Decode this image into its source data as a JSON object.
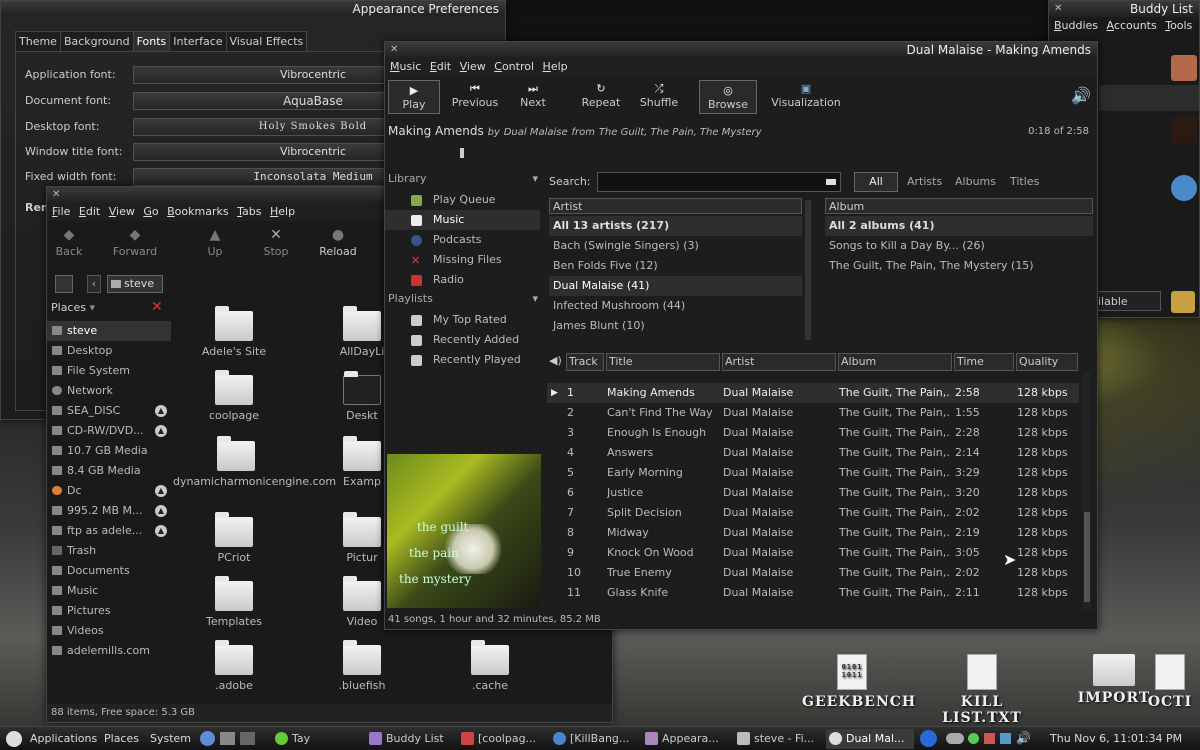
{
  "appearance": {
    "title": "Appearance Preferences",
    "tabs": [
      "Theme",
      "Background",
      "Fonts",
      "Interface",
      "Visual Effects"
    ],
    "rows": [
      {
        "label": "Application font:",
        "value": "Vibrocentric"
      },
      {
        "label": "Document font:",
        "value": "AquaBase"
      },
      {
        "label": "Desktop font:",
        "value": "Holy Smokes Bold"
      },
      {
        "label": "Window title font:",
        "value": "Vibrocentric"
      },
      {
        "label": "Fixed width font:",
        "value": "Inconsolata Medium"
      }
    ],
    "partial_label": "Ren"
  },
  "files": {
    "menu": [
      "File",
      "Edit",
      "View",
      "Go",
      "Bookmarks",
      "Tabs",
      "Help"
    ],
    "toolbar": [
      "Back",
      "Forward",
      "Up",
      "Stop",
      "Reload"
    ],
    "location": "steve",
    "places_label": "Places",
    "places": [
      "steve",
      "Desktop",
      "File System",
      "Network",
      "SEA_DISC",
      "CD-RW/DVD...",
      "10.7 GB Media",
      "8.4 GB Media",
      "Dc",
      "995.2 MB M...",
      "ftp as adele...",
      "Trash",
      "Documents",
      "Music",
      "Pictures",
      "Videos",
      "adelemills.com"
    ],
    "items": [
      "Adele's Site",
      "AllDayLi",
      "coolpage",
      "Deskt",
      "dynamicharmonicengine.com",
      "Examp",
      "PCriot",
      "Pictur",
      "Templates",
      "Video",
      ".adobe",
      ".bluefish",
      ".cache"
    ],
    "status": "88 items, Free space: 5.3 GB"
  },
  "music": {
    "title": "Dual Malaise - Making Amends",
    "menu": [
      "Music",
      "Edit",
      "View",
      "Control",
      "Help"
    ],
    "toolbar": [
      "Play",
      "Previous",
      "Next",
      "Repeat",
      "Shuffle",
      "Browse",
      "Visualization"
    ],
    "song": "Making Amends",
    "by": "by",
    "artist": "Dual Malaise",
    "from": "from",
    "album": "The Guilt, The Pain, The Mystery",
    "time": "0:18 of 2:58",
    "library_label": "Library",
    "library": [
      "Play Queue",
      "Music",
      "Podcasts",
      "Missing Files",
      "Radio"
    ],
    "playlists_label": "Playlists",
    "playlists": [
      "My Top Rated",
      "Recently Added",
      "Recently Played"
    ],
    "search_label": "Search:",
    "filters": [
      "All",
      "Artists",
      "Albums",
      "Titles"
    ],
    "artist_header": "Artist",
    "artists": [
      "All 13 artists (217)",
      "Bach (Swingle Singers) (3)",
      "Ben Folds Five (12)",
      "Dual Malaise (41)",
      "Infected Mushroom (44)",
      "James Blunt (10)"
    ],
    "album_header": "Album",
    "albums": [
      "All 2 albums (41)",
      "Songs to Kill a Day By... (26)",
      "The Guilt, The Pain, The Mystery (15)"
    ],
    "columns": [
      "Track",
      "Title",
      "Artist",
      "Album",
      "Time",
      "Quality"
    ],
    "tracks": [
      {
        "n": "1",
        "title": "Making Amends",
        "artist": "Dual Malaise",
        "album": "The Guilt, The Pain,...",
        "time": "2:58",
        "q": "128 kbps"
      },
      {
        "n": "2",
        "title": "Can't Find The Way",
        "artist": "Dual Malaise",
        "album": "The Guilt, The Pain,...",
        "time": "1:55",
        "q": "128 kbps"
      },
      {
        "n": "3",
        "title": "Enough Is Enough",
        "artist": "Dual Malaise",
        "album": "The Guilt, The Pain,...",
        "time": "2:28",
        "q": "128 kbps"
      },
      {
        "n": "4",
        "title": "Answers",
        "artist": "Dual Malaise",
        "album": "The Guilt, The Pain,...",
        "time": "2:14",
        "q": "128 kbps"
      },
      {
        "n": "5",
        "title": "Early Morning",
        "artist": "Dual Malaise",
        "album": "The Guilt, The Pain,...",
        "time": "3:29",
        "q": "128 kbps"
      },
      {
        "n": "6",
        "title": "Justice",
        "artist": "Dual Malaise",
        "album": "The Guilt, The Pain,...",
        "time": "3:20",
        "q": "128 kbps"
      },
      {
        "n": "7",
        "title": "Split Decision",
        "artist": "Dual Malaise",
        "album": "The Guilt, The Pain,...",
        "time": "2:02",
        "q": "128 kbps"
      },
      {
        "n": "8",
        "title": "Midway",
        "artist": "Dual Malaise",
        "album": "The Guilt, The Pain,...",
        "time": "2:19",
        "q": "128 kbps"
      },
      {
        "n": "9",
        "title": "Knock On Wood",
        "artist": "Dual Malaise",
        "album": "The Guilt, The Pain,...",
        "time": "3:05",
        "q": "128 kbps"
      },
      {
        "n": "10",
        "title": "True Enemy",
        "artist": "Dual Malaise",
        "album": "The Guilt, The Pain,...",
        "time": "2:02",
        "q": "128 kbps"
      },
      {
        "n": "11",
        "title": "Glass Knife",
        "artist": "Dual Malaise",
        "album": "The Guilt, The Pain,...",
        "time": "2:11",
        "q": "128 kbps"
      }
    ],
    "art_lines": [
      "the guilt",
      "the pain",
      "the mystery"
    ],
    "status": "41 songs, 1 hour and 32 minutes, 85.2 MB"
  },
  "buddy": {
    "title": "Buddy List",
    "menu": [
      "Buddies",
      "Accounts",
      "Tools"
    ],
    "status": "ilable"
  },
  "desktop": {
    "icons": [
      "GEEKBENCH",
      "KILL LIST.TXT",
      "IMPORT",
      "OCTI"
    ]
  },
  "taskbar": {
    "menus": [
      "Applications",
      "Places",
      "System"
    ],
    "tasks": [
      "Tay",
      "Buddy List",
      "[coolpag...",
      "[KillBang...",
      "Appeara...",
      "steve - Fi...",
      "Dual Mal..."
    ],
    "clock": "Thu Nov 6, 11:01:34 PM"
  }
}
